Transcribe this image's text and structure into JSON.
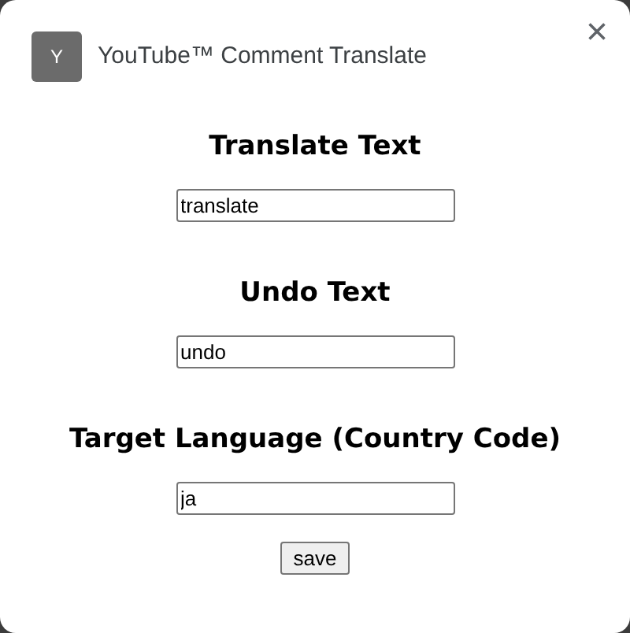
{
  "header": {
    "app_icon_letter": "Y",
    "title": "YouTube™ Comment Translate",
    "close": "×"
  },
  "fields": [
    {
      "label": "Translate Text",
      "value": "translate"
    },
    {
      "label": "Undo Text",
      "value": "undo"
    },
    {
      "label": "Target Language (Country Code)",
      "value": "ja"
    }
  ],
  "buttons": [
    "save"
  ]
}
